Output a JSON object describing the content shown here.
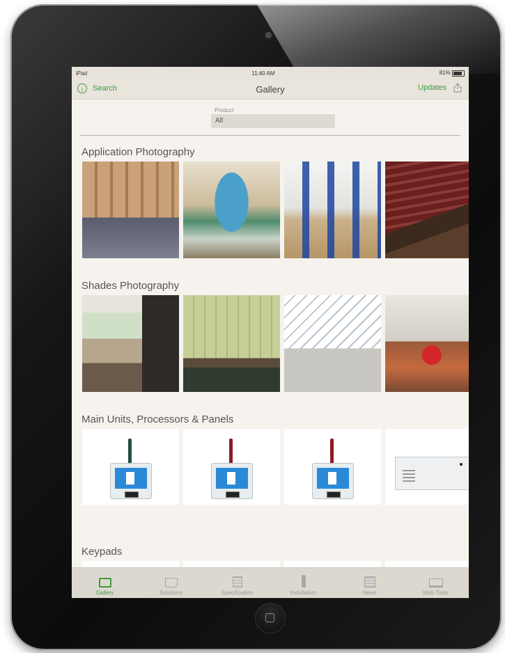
{
  "status": {
    "device": "iPad",
    "time": "11:40 AM",
    "battery": "81%"
  },
  "nav": {
    "search_label": "Search",
    "title": "Gallery",
    "updates_label": "Updates"
  },
  "filter": {
    "label": "Product",
    "value": "All"
  },
  "sections": [
    {
      "title": "Application Photography"
    },
    {
      "title": "Shades Photography"
    },
    {
      "title": "Main Units, Processors & Panels"
    },
    {
      "title": "Keypads"
    }
  ],
  "tabs": [
    {
      "label": "Gallery",
      "icon": "gallery-icon",
      "active": true
    },
    {
      "label": "Solutions",
      "icon": "solutions-icon"
    },
    {
      "label": "Specification",
      "icon": "specification-icon"
    },
    {
      "label": "Installation",
      "icon": "installation-icon"
    },
    {
      "label": "News",
      "icon": "news-icon"
    },
    {
      "label": "Web Tools",
      "icon": "web-tools-icon"
    }
  ],
  "colors": {
    "accent": "#3f9a3f",
    "screen_bg": "#f6f3ee",
    "bar_bg": "#e9e4dc"
  }
}
